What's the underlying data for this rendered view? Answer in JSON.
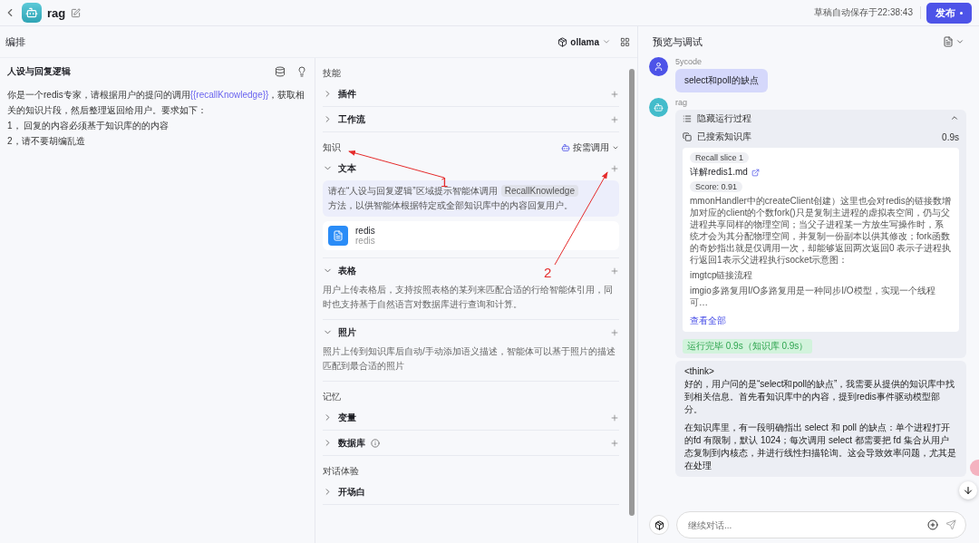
{
  "header": {
    "title": "rag",
    "autosave": "草稿自动保存于22:38:43",
    "publish": "发布"
  },
  "editor": {
    "title": "编排",
    "model": "ollama",
    "prompt": {
      "title": "人设与回复逻辑",
      "intro": [
        {
          "kind": "plain",
          "text": "你是一个redis专家，请根据用户的提问的调用"
        },
        {
          "kind": "variable",
          "text": "{{recallKnowledge}}"
        },
        {
          "kind": "plain",
          "text": "，获取相关的知识片段，然后整理返回给用户。要求如下："
        }
      ],
      "lines": [
        "1， 回复的内容必须基于知识库的的内容",
        "2，请不要胡编乱造"
      ]
    }
  },
  "config": {
    "sections": [
      {
        "title": "技能",
        "items": [
          {
            "label": "插件",
            "expanded": false,
            "addable": true
          },
          {
            "label": "工作流",
            "expanded": false,
            "addable": true
          }
        ]
      },
      {
        "title": "知识",
        "mode": "按需调用",
        "items": [
          {
            "label": "文本",
            "expanded": true,
            "addable": true,
            "hint": {
              "before": "请在“人设与回复逻辑”区域提示智能体调用",
              "tag": "RecallKnowledge",
              "after": "方法，以供智能体根据特定或全部知识库中的内容回复用户。"
            },
            "datasets": [
              {
                "name": "redis",
                "sub": "redis"
              }
            ]
          },
          {
            "label": "表格",
            "expanded": true,
            "addable": true,
            "description": "用户上传表格后，支持按照表格的某列来匹配合适的行给智能体引用，同时也支持基于自然语言对数据库进行查询和计算。"
          },
          {
            "label": "照片",
            "expanded": true,
            "addable": true,
            "description": "照片上传到知识库后自动/手动添加语义描述，智能体可以基于照片的描述匹配到最合适的照片"
          }
        ]
      },
      {
        "title": "记忆",
        "items": [
          {
            "label": "变量",
            "expanded": false,
            "addable": true
          },
          {
            "label": "数据库",
            "expanded": false,
            "addable": true,
            "info": true
          }
        ]
      },
      {
        "title": "对话体验",
        "items": [
          {
            "label": "开场白",
            "expanded": false,
            "addable": false
          }
        ]
      }
    ]
  },
  "chat": {
    "title": "预览与调试",
    "user": {
      "name": "5ycode",
      "text": "select和poll的缺点"
    },
    "bot": {
      "name": "rag",
      "process": {
        "toggle": "隐藏运行过程",
        "expanded": true,
        "step": "已搜索知识库",
        "time": "0.9s",
        "slice": {
          "tag": "Recall slice 1",
          "file": "详解redis1.md",
          "score": "Score: 0.91",
          "paragraphs": [
            "mmonHandler中的createClient创建）这里也会对redis的链接数增加对应的client的个数fork()只是复制主进程的虚拟表空间，仍与父进程共享同样的物理空间；当父子进程某一方放生写操作时，系统才会为其分配物理空间，并复制一份副本以供其修改；fork函数的奇妙指出就是仅调用一次，却能够返回两次返回0 表示子进程执行返回1表示父进程执行socket示意图：",
            "imgtcp链接流程",
            "imgio多路复用I/O多路复用是一种同步I/O模型，实现一个线程可…"
          ],
          "more": "查看全部"
        },
        "status": "运行完毕 0.9s（知识库 0.9s）"
      },
      "reply": [
        "<think>",
        "好的，用户问的是“select和poll的缺点”，我需要从提供的知识库中找到相关信息。首先看知识库中的内容，提到redis事件驱动模型部分。",
        "在知识库里，有一段明确指出 select 和 poll 的缺点：单个进程打开的fd 有限制，默认 1024；每次调用 select 都需要把 fd 集合从用户态复制到内核态，并进行线性扫描轮询。这会导致效率问题，尤其是在处理"
      ]
    },
    "input": {
      "placeholder": "继续对话..."
    }
  },
  "annotations": [
    {
      "label": "1"
    },
    {
      "label": "2"
    }
  ]
}
